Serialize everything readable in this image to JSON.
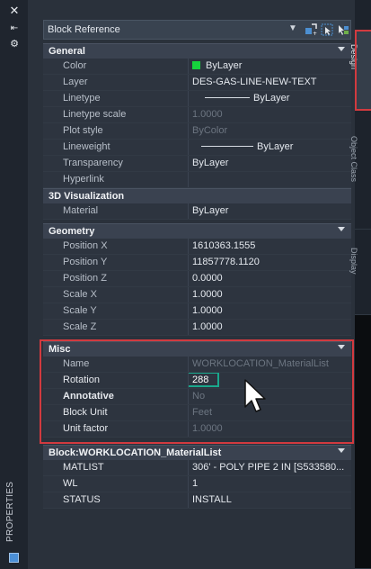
{
  "left_strip": {
    "title": "PROPERTIES"
  },
  "selector": {
    "value": "Block Reference"
  },
  "tabs": [
    {
      "label": "Design"
    },
    {
      "label": "Object Class"
    },
    {
      "label": "Display"
    }
  ],
  "sections": {
    "general": {
      "title": "General",
      "rows": [
        {
          "name": "Color",
          "value": "ByLayer"
        },
        {
          "name": "Layer",
          "value": "DES-GAS-LINE-NEW-TEXT"
        },
        {
          "name": "Linetype",
          "value": "ByLayer"
        },
        {
          "name": "Linetype scale",
          "value": "1.0000"
        },
        {
          "name": "Plot style",
          "value": "ByColor"
        },
        {
          "name": "Lineweight",
          "value": "ByLayer"
        },
        {
          "name": "Transparency",
          "value": "ByLayer"
        },
        {
          "name": "Hyperlink",
          "value": ""
        }
      ]
    },
    "visualization": {
      "title": "3D Visualization",
      "rows": [
        {
          "name": "Material",
          "value": "ByLayer"
        }
      ]
    },
    "geometry": {
      "title": "Geometry",
      "rows": [
        {
          "name": "Position X",
          "value": "1610363.1555"
        },
        {
          "name": "Position Y",
          "value": "11857778.1120"
        },
        {
          "name": "Position Z",
          "value": "0.0000"
        },
        {
          "name": "Scale X",
          "value": "1.0000"
        },
        {
          "name": "Scale Y",
          "value": "1.0000"
        },
        {
          "name": "Scale Z",
          "value": "1.0000"
        }
      ]
    },
    "misc": {
      "title": "Misc",
      "rows": [
        {
          "name": "Name",
          "value": "WORKLOCATION_MaterialList"
        },
        {
          "name": "Rotation",
          "value": "288"
        },
        {
          "name": "Annotative",
          "value": "No"
        },
        {
          "name": "Block Unit",
          "value": "Feet"
        },
        {
          "name": "Unit factor",
          "value": "1.0000"
        }
      ]
    },
    "block": {
      "title": "Block:WORKLOCATION_MaterialList",
      "rows": [
        {
          "name": "MATLIST",
          "value": "306' - POLY PIPE 2 IN [S533580..."
        },
        {
          "name": "WL",
          "value": "1"
        },
        {
          "name": "STATUS",
          "value": "INSTALL"
        }
      ]
    }
  },
  "colors": {
    "highlight_red": "#d23a3f",
    "rotation_box": "#1aa88d",
    "color_swatch": "#16d43d"
  }
}
